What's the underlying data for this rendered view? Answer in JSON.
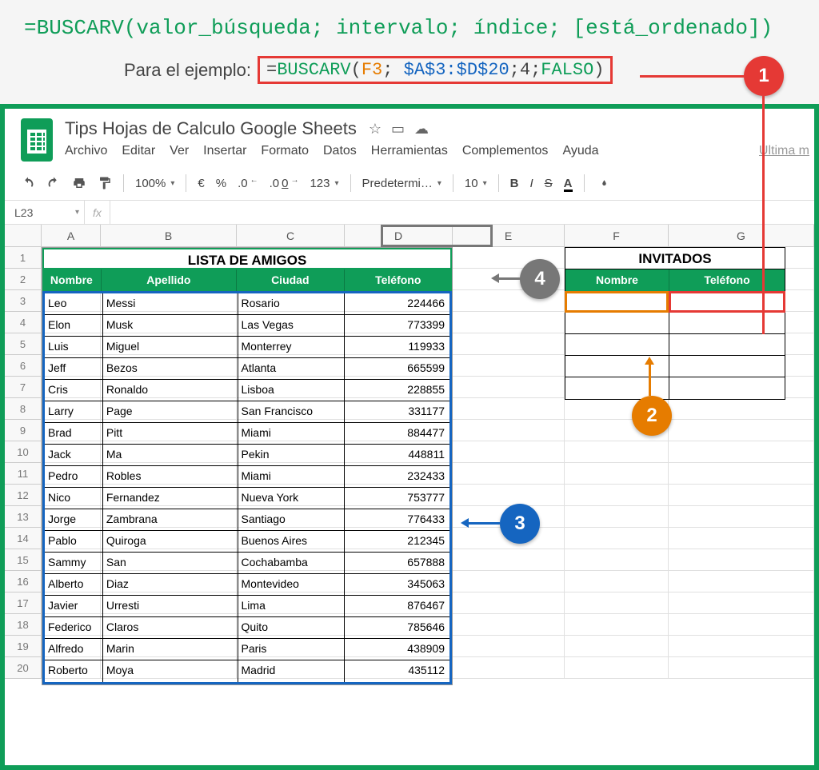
{
  "formula": {
    "syntax": "=BUSCARV(valor_búsqueda; intervalo; índice; [está_ordenado])",
    "example_prefix": "Para el ejemplo:",
    "eq": "=",
    "fn": "BUSCARV",
    "open": "(",
    "arg1": "F3",
    "sep1": ";",
    "arg2": " $A$3:$D$20",
    "sep2": ";",
    "arg3": "4",
    "sep3": ";",
    "arg4": "FALSO",
    "close": ")"
  },
  "doc": {
    "title": "Tips Hojas de Calculo Google Sheets",
    "last_mod": "Última m"
  },
  "menu": {
    "archivo": "Archivo",
    "editar": "Editar",
    "ver": "Ver",
    "insertar": "Insertar",
    "formato": "Formato",
    "datos": "Datos",
    "herramientas": "Herramientas",
    "complementos": "Complementos",
    "ayuda": "Ayuda"
  },
  "toolbar": {
    "zoom": "100%",
    "currency": "€",
    "percent": "%",
    "dec_dec": ".0",
    "inc_dec": ".00",
    "numfmt": "123",
    "font": "Predetermi…",
    "fontsize": "10",
    "bold": "B",
    "italic": "I",
    "strike": "S",
    "textcolor": "A"
  },
  "namebox": "L23",
  "fx": "fx",
  "columns": {
    "A": "A",
    "B": "B",
    "C": "C",
    "D": "D",
    "E": "E",
    "F": "F",
    "G": "G"
  },
  "rows": [
    "1",
    "2",
    "3",
    "4",
    "5",
    "6",
    "7",
    "8",
    "9",
    "10",
    "11",
    "12",
    "13",
    "14",
    "15",
    "16",
    "17",
    "18",
    "19",
    "20"
  ],
  "table": {
    "title": "LISTA DE AMIGOS",
    "headers": {
      "nombre": "Nombre",
      "apellido": "Apellido",
      "ciudad": "Ciudad",
      "telefono": "Teléfono"
    },
    "rows": [
      {
        "n": "Leo",
        "a": "Messi",
        "c": "Rosario",
        "t": "224466"
      },
      {
        "n": "Elon",
        "a": "Musk",
        "c": "Las Vegas",
        "t": "773399"
      },
      {
        "n": "Luis",
        "a": "Miguel",
        "c": "Monterrey",
        "t": "119933"
      },
      {
        "n": "Jeff",
        "a": "Bezos",
        "c": "Atlanta",
        "t": "665599"
      },
      {
        "n": "Cris",
        "a": "Ronaldo",
        "c": "Lisboa",
        "t": "228855"
      },
      {
        "n": "Larry",
        "a": "Page",
        "c": "San Francisco",
        "t": "331177"
      },
      {
        "n": "Brad",
        "a": "Pitt",
        "c": "Miami",
        "t": "884477"
      },
      {
        "n": "Jack",
        "a": "Ma",
        "c": "Pekin",
        "t": "448811"
      },
      {
        "n": "Pedro",
        "a": "Robles",
        "c": "Miami",
        "t": "232433"
      },
      {
        "n": "Nico",
        "a": "Fernandez",
        "c": "Nueva York",
        "t": "753777"
      },
      {
        "n": "Jorge",
        "a": "Zambrana",
        "c": "Santiago",
        "t": "776433"
      },
      {
        "n": "Pablo",
        "a": "Quiroga",
        "c": "Buenos Aires",
        "t": "212345"
      },
      {
        "n": "Sammy",
        "a": "San",
        "c": "Cochabamba",
        "t": "657888"
      },
      {
        "n": "Alberto",
        "a": "Diaz",
        "c": "Montevideo",
        "t": "345063"
      },
      {
        "n": "Javier",
        "a": "Urresti",
        "c": "Lima",
        "t": "876467"
      },
      {
        "n": "Federico",
        "a": "Claros",
        "c": "Quito",
        "t": "785646"
      },
      {
        "n": "Alfredo",
        "a": "Marin",
        "c": "Paris",
        "t": "438909"
      },
      {
        "n": "Roberto",
        "a": "Moya",
        "c": "Madrid",
        "t": "435112"
      }
    ]
  },
  "invitados": {
    "title": "INVITADOS",
    "headers": {
      "nombre": "Nombre",
      "telefono": "Teléfono"
    }
  },
  "callouts": {
    "c1": "1",
    "c2": "2",
    "c3": "3",
    "c4": "4"
  }
}
